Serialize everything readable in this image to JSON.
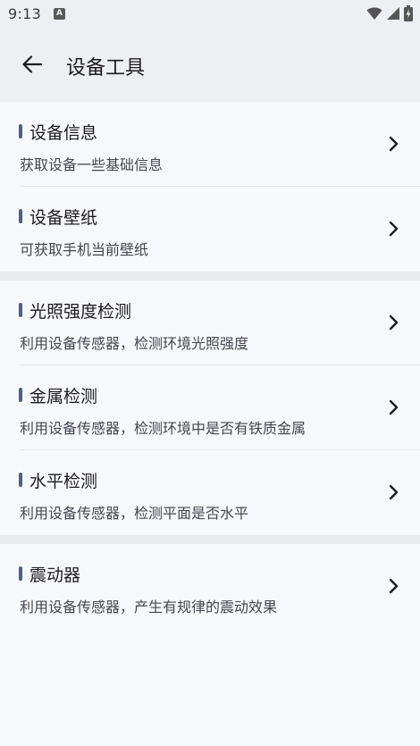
{
  "status_bar": {
    "time": "9:13",
    "notification_icon": "A"
  },
  "header": {
    "title": "设备工具"
  },
  "sections": [
    {
      "items": [
        {
          "title": "设备信息",
          "description": "获取设备一些基础信息"
        },
        {
          "title": "设备壁纸",
          "description": "可获取手机当前壁纸"
        }
      ]
    },
    {
      "items": [
        {
          "title": "光照强度检测",
          "description": "利用设备传感器，检测环境光照强度"
        },
        {
          "title": "金属检测",
          "description": "利用设备传感器，检测环境中是否有铁质金属"
        },
        {
          "title": "水平检测",
          "description": "利用设备传感器，检测平面是否水平"
        }
      ]
    },
    {
      "items": [
        {
          "title": "震动器",
          "description": "利用设备传感器，产生有规律的震动效果"
        }
      ]
    }
  ],
  "colors": {
    "accent": "#4a6285",
    "background": "#f7f8fc",
    "app_bar": "#eeeff3"
  }
}
